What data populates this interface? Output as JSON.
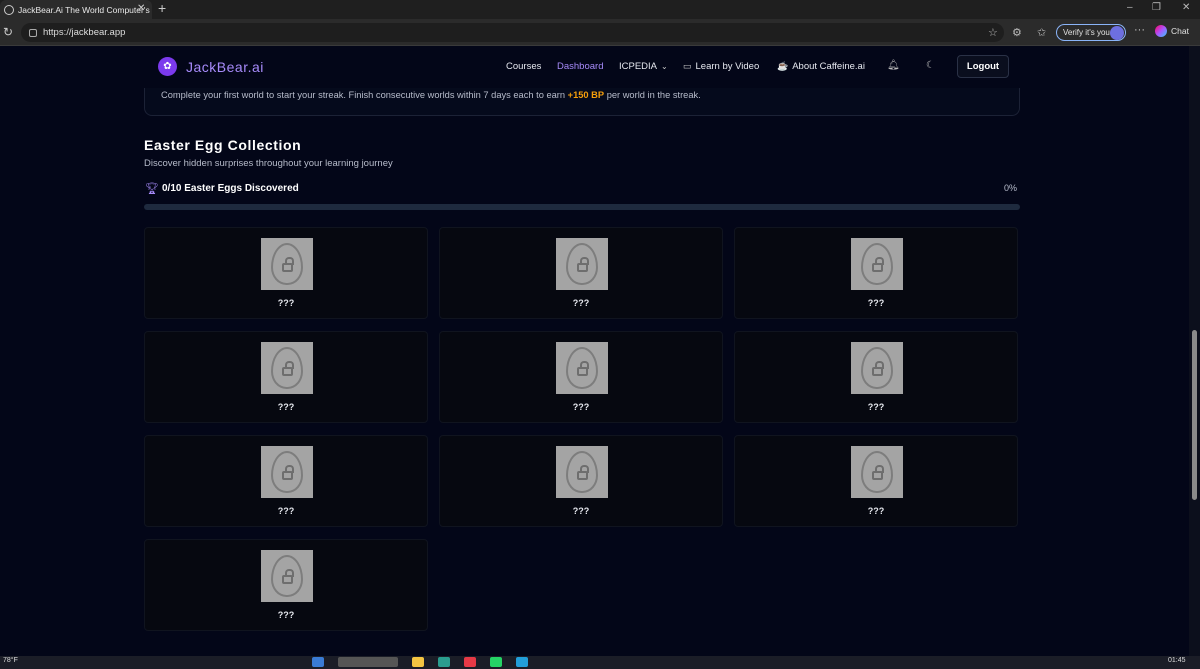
{
  "browser": {
    "tab_title": "JackBear.Ai The World Computer's",
    "url": "https://jackbear.app",
    "verify_label": "Verify it's you",
    "chat_label": "Chat"
  },
  "header": {
    "logo_text": "JackBear.ai",
    "nav": {
      "courses": "Courses",
      "dashboard": "Dashboard",
      "icpedia": "ICPEDIA",
      "learn_by_video": "Learn by Video",
      "about": "About Caffeine.ai"
    },
    "logout_label": "Logout"
  },
  "streak": {
    "text_before": "Complete your first world to start your streak. Finish consecutive worlds within 7 days each to earn ",
    "bp": "+150 BP",
    "text_after": " per world in the streak."
  },
  "easter_eggs": {
    "title": "Easter Egg Collection",
    "subtitle": "Discover hidden surprises throughout your learning journey",
    "progress_label": "0/10 Easter Eggs Discovered",
    "progress_percent": "0%",
    "progress_value": 0,
    "cards": [
      {
        "label": "???"
      },
      {
        "label": "???"
      },
      {
        "label": "???"
      },
      {
        "label": "???"
      },
      {
        "label": "???"
      },
      {
        "label": "???"
      },
      {
        "label": "???"
      },
      {
        "label": "???"
      },
      {
        "label": "???"
      },
      {
        "label": "???"
      }
    ]
  },
  "taskbar": {
    "temperature": "78°F",
    "time": "01:45"
  },
  "colors": {
    "background": "#030618",
    "accent": "#a78bfa",
    "bp_highlight": "#f59e0b"
  }
}
